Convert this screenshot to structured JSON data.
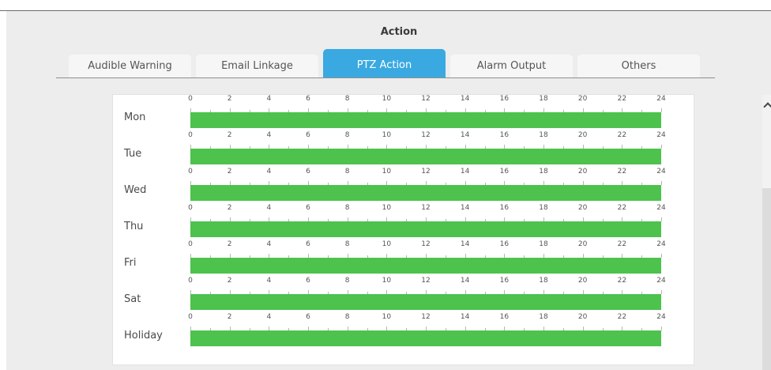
{
  "dialog": {
    "title": "Action"
  },
  "tabs": [
    {
      "label": "Audible Warning",
      "active": false
    },
    {
      "label": "Email Linkage",
      "active": false
    },
    {
      "label": "PTZ Action",
      "active": true
    },
    {
      "label": "Alarm Output",
      "active": false
    },
    {
      "label": "Others",
      "active": false
    }
  ],
  "schedule": {
    "hour_ticks": [
      "0",
      "2",
      "4",
      "6",
      "8",
      "10",
      "12",
      "14",
      "16",
      "18",
      "20",
      "22",
      "24"
    ],
    "days": [
      {
        "label": "Mon",
        "armed_from_hour": 0,
        "armed_to_hour": 24
      },
      {
        "label": "Tue",
        "armed_from_hour": 0,
        "armed_to_hour": 24
      },
      {
        "label": "Wed",
        "armed_from_hour": 0,
        "armed_to_hour": 24
      },
      {
        "label": "Thu",
        "armed_from_hour": 0,
        "armed_to_hour": 24
      },
      {
        "label": "Fri",
        "armed_from_hour": 0,
        "armed_to_hour": 24
      },
      {
        "label": "Sat",
        "armed_from_hour": 0,
        "armed_to_hour": 24
      },
      {
        "label": "Holiday",
        "armed_from_hour": 0,
        "armed_to_hour": 24
      }
    ],
    "bar_color": "#4dc24d"
  },
  "colors": {
    "active_tab": "#3aa9e2",
    "panel_bg": "#ededed"
  },
  "icons": {
    "scroll_up": "chevron-up-icon"
  }
}
